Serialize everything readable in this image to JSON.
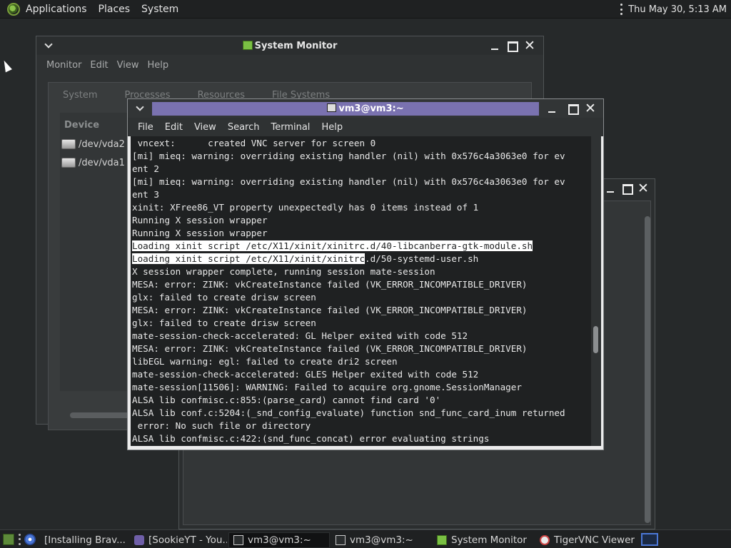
{
  "top_panel": {
    "menus": [
      "Applications",
      "Places",
      "System"
    ],
    "clock": "Thu May 30,  5:13 AM"
  },
  "system_monitor": {
    "title": "System Monitor",
    "menus": [
      "Monitor",
      "Edit",
      "View",
      "Help"
    ],
    "tabs": [
      "System",
      "Processes",
      "Resources",
      "File Systems"
    ],
    "devices_header": "Device",
    "devices": [
      "/dev/vda2",
      "/dev/vda1"
    ]
  },
  "terminal": {
    "title": "vm3@vm3:~",
    "menus": [
      "File",
      "Edit",
      "View",
      "Search",
      "Terminal",
      "Help"
    ],
    "lines": [
      " vncext:      created VNC server for screen 0",
      "[mi] mieq: warning: overriding existing handler (nil) with 0x576c4a3063e0 for ev",
      "ent 2",
      "[mi] mieq: warning: overriding existing handler (nil) with 0x576c4a3063e0 for ev",
      "ent 3",
      "xinit: XFree86_VT property unexpectedly has 0 items instead of 1",
      "Running X session wrapper",
      "Running X session wrapper",
      "Loading xinit script /etc/X11/xinit/xinitrc.d/40-libcanberra-gtk-module.sh",
      "Loading xinit script /etc/X11/xinit/xinitrc.d/50-systemd-user.sh",
      "X session wrapper complete, running session mate-session",
      "MESA: error: ZINK: vkCreateInstance failed (VK_ERROR_INCOMPATIBLE_DRIVER)",
      "glx: failed to create drisw screen",
      "MESA: error: ZINK: vkCreateInstance failed (VK_ERROR_INCOMPATIBLE_DRIVER)",
      "glx: failed to create drisw screen",
      "mate-session-check-accelerated: GL Helper exited with code 512",
      "MESA: error: ZINK: vkCreateInstance failed (VK_ERROR_INCOMPATIBLE_DRIVER)",
      "libEGL warning: egl: failed to create dri2 screen",
      "mate-session-check-accelerated: GLES Helper exited with code 512",
      "mate-session[11506]: WARNING: Failed to acquire org.gnome.SessionManager",
      "ALSA lib confmisc.c:855:(parse_card) cannot find card '0'",
      "ALSA lib conf.c:5204:(_snd_config_evaluate) function snd_func_card_inum returned",
      " error: No such file or directory",
      "ALSA lib confmisc.c:422:(snd_func_concat) error evaluating strings"
    ],
    "selection": {
      "line8": "Loading xinit script /etc/X11/xinit/xinitrc.d/40-libcanberra-gtk-module.sh",
      "line9_selected": "Loading xinit script /etc/X11/xinit/xinitrc",
      "line9_rest": ".d/50-systemd-user.sh"
    }
  },
  "taskbar": {
    "tasks": [
      "[Installing Brav...",
      "[SookieYT - You...",
      "vm3@vm3:~",
      "vm3@vm3:~",
      "System Monitor",
      "TigerVNC Viewer"
    ]
  }
}
